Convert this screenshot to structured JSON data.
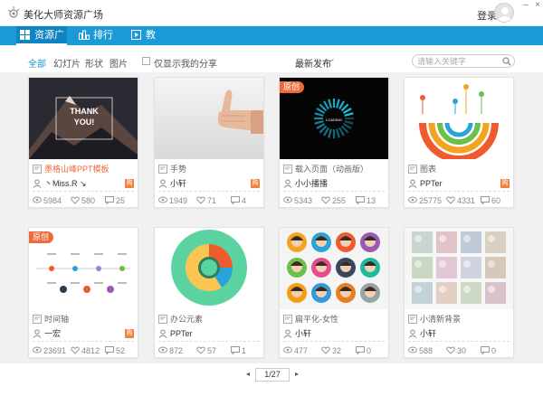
{
  "app": {
    "title": "美化大师资源广场",
    "login": "登录"
  },
  "nav": [
    {
      "label": "资源广场",
      "active": true
    },
    {
      "label": "排行榜",
      "active": false
    },
    {
      "label": "教程",
      "active": false
    }
  ],
  "filters": {
    "tabs": [
      "全部",
      "幻灯片",
      "形状",
      "图片"
    ],
    "only_mine": "仅显示我的分享",
    "sort": "最新发布",
    "search_placeholder": "请输入关键字"
  },
  "cards": [
    {
      "title": "墨格山峰PPT模板",
      "author": "丶Miss.R ↘",
      "views": "5984",
      "likes": "580",
      "comments": "25",
      "original": false,
      "buy": true,
      "highlight": true,
      "thumb_text": "THANK YOU!"
    },
    {
      "title": "手势",
      "author": "小轩",
      "views": "1949",
      "likes": "71",
      "comments": "4",
      "original": false,
      "buy": true,
      "highlight": false
    },
    {
      "title": "载入页面（动画版）",
      "author": "小小播播",
      "views": "5343",
      "likes": "255",
      "comments": "13",
      "original": true,
      "buy": false,
      "highlight": false
    },
    {
      "title": "图表",
      "author": "PPTer",
      "views": "25775",
      "likes": "4331",
      "comments": "60",
      "original": false,
      "buy": true,
      "highlight": false
    },
    {
      "title": "时间轴",
      "author": "一宏",
      "views": "23691",
      "likes": "4812",
      "comments": "52",
      "original": true,
      "buy": true,
      "highlight": false
    },
    {
      "title": "办公元素",
      "author": "PPTer",
      "views": "872",
      "likes": "57",
      "comments": "1",
      "original": false,
      "buy": false,
      "highlight": false
    },
    {
      "title": "扁平化-女性",
      "author": "小轩",
      "views": "477",
      "likes": "32",
      "comments": "0",
      "original": false,
      "buy": false,
      "highlight": false
    },
    {
      "title": "小清新背景",
      "author": "小轩",
      "views": "588",
      "likes": "30",
      "comments": "0",
      "original": false,
      "buy": false,
      "highlight": false
    }
  ],
  "badge_label": "原创",
  "buy_label": "购",
  "pager": {
    "current": "1/27",
    "prev": "◂",
    "next": "▸"
  },
  "colors": {
    "accent": "#1b9ad8",
    "badge": "#ee6a3b"
  }
}
